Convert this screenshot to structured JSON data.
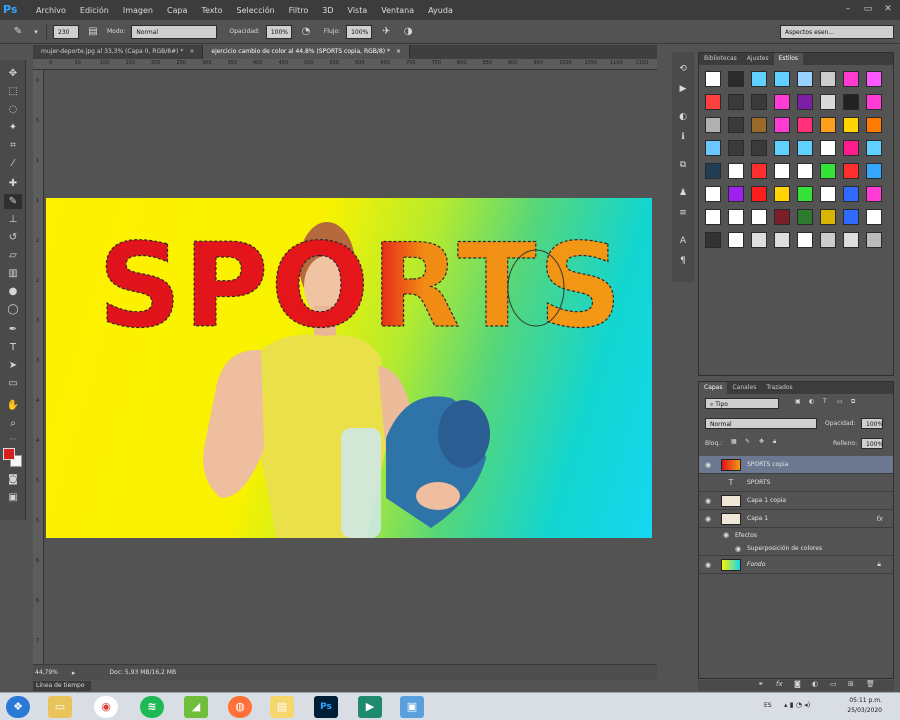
{
  "app": {
    "logo": "Ps"
  },
  "menu": [
    "Archivo",
    "Edición",
    "Imagen",
    "Capa",
    "Texto",
    "Selección",
    "Filtro",
    "3D",
    "Vista",
    "Ventana",
    "Ayuda"
  ],
  "window_controls": [
    "–",
    "▭",
    "✕"
  ],
  "options": {
    "brush_size": "230",
    "mode_label": "Modo:",
    "mode_value": "Normal",
    "opacity_label": "Opacidad:",
    "opacity_value": "100%",
    "flow_label": "Flujo:",
    "flow_value": "100%",
    "workspace": "Aspectos esen..."
  },
  "tabs": [
    {
      "label": "mujer-deporte.jpg al 33,3% (Capa 0, RGB/8#) *",
      "close": "×"
    },
    {
      "label": "ejercicio cambio de color al 44,8% (SPORTS copia, RGB/8) *",
      "close": "×"
    }
  ],
  "ruler_top": [
    "0",
    "50",
    "100",
    "150",
    "200",
    "250",
    "300",
    "350",
    "400",
    "450",
    "500",
    "550",
    "600",
    "650",
    "700",
    "750",
    "800",
    "850",
    "900",
    "950",
    "1000",
    "1050",
    "1100",
    "1150"
  ],
  "ruler_left": [
    "0",
    "5",
    "1",
    "1",
    "2",
    "2",
    "3",
    "3",
    "4",
    "4",
    "5",
    "5",
    "6",
    "6",
    "7"
  ],
  "canvas": {
    "headline": "SPORTS"
  },
  "status": {
    "zoom": "44,79%",
    "doc": "Doc: 5,93 MB/16,2 MB"
  },
  "timeline_tab": "Línea de tiempo",
  "style_panel": {
    "tabs": [
      "Bibliotecas",
      "Ajustes",
      "Estilos"
    ],
    "active_tab": "Estilos"
  },
  "layers_panel": {
    "tabs": [
      "Capas",
      "Canales",
      "Trazados"
    ],
    "active_tab": "Capas",
    "filter": "Tipo",
    "blend_mode": "Normal",
    "opacity_label": "Opacidad:",
    "opacity_value": "100%",
    "lock_label": "Bloq.:",
    "fill_label": "Relleno:",
    "fill_value": "100%",
    "layers": [
      {
        "name": "SPORTS copia",
        "selected": true
      },
      {
        "name": "SPORTS",
        "type_icon": "T"
      },
      {
        "name": "Capa 1 copia"
      },
      {
        "name": "Capa 1",
        "fx": "fx"
      },
      {
        "name": "Efectos",
        "sub": true
      },
      {
        "name": "Superposición de colores",
        "sub": true
      },
      {
        "name": "Fondo",
        "locked": true
      }
    ]
  },
  "taskbar": {
    "language": "ES",
    "time": "05:11 p.m.",
    "date": "25/03/2020"
  },
  "colors": {
    "menu_bg": "#3c3c3c",
    "panel_bg": "#535353",
    "headline_red": "#e0131c",
    "headline_orange": "#f29a14",
    "foreground": "#d61f1f",
    "background": "#f7f7f7",
    "selected_layer": "#6b7890"
  }
}
